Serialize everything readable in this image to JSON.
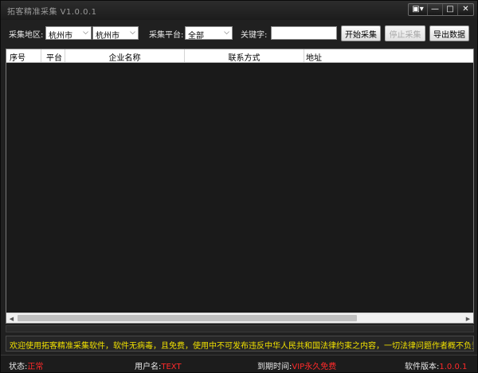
{
  "window": {
    "title": "拓客精准采集 V1.0.0.1",
    "buttons": {
      "skin": "▣▾",
      "minimize": "—",
      "maximize": "□",
      "close": "✕"
    }
  },
  "toolbar": {
    "region_label": "采集地区:",
    "province_value": "杭州市",
    "city_value": "杭州市",
    "platform_label": "采集平台:",
    "platform_value": "全部",
    "keyword_label": "关键字:",
    "keyword_value": "",
    "start_label": "开始采集",
    "stop_label": "停止采集",
    "export_label": "导出数据"
  },
  "table": {
    "columns": [
      "序号",
      "平台",
      "企业名称",
      "联系方式",
      "地址"
    ],
    "rows": []
  },
  "notice": "欢迎使用拓客精准采集软件，软件无病毒，且免费，使用中不可发布违反中华人民共和国法律约束之内容，一切法律问题作者概不负责!",
  "status": {
    "state_label": "状态:",
    "state_value": "正常",
    "user_label": "用户名:",
    "user_value": "TEXT",
    "expire_label": "到期时间:",
    "expire_value": "VIP永久免费",
    "version_label": "软件版本:",
    "version_value": "1.0.0.1"
  },
  "colors": {
    "background": "#202020",
    "notice_text": "#f0e000",
    "status_value": "#ff2a2a"
  }
}
